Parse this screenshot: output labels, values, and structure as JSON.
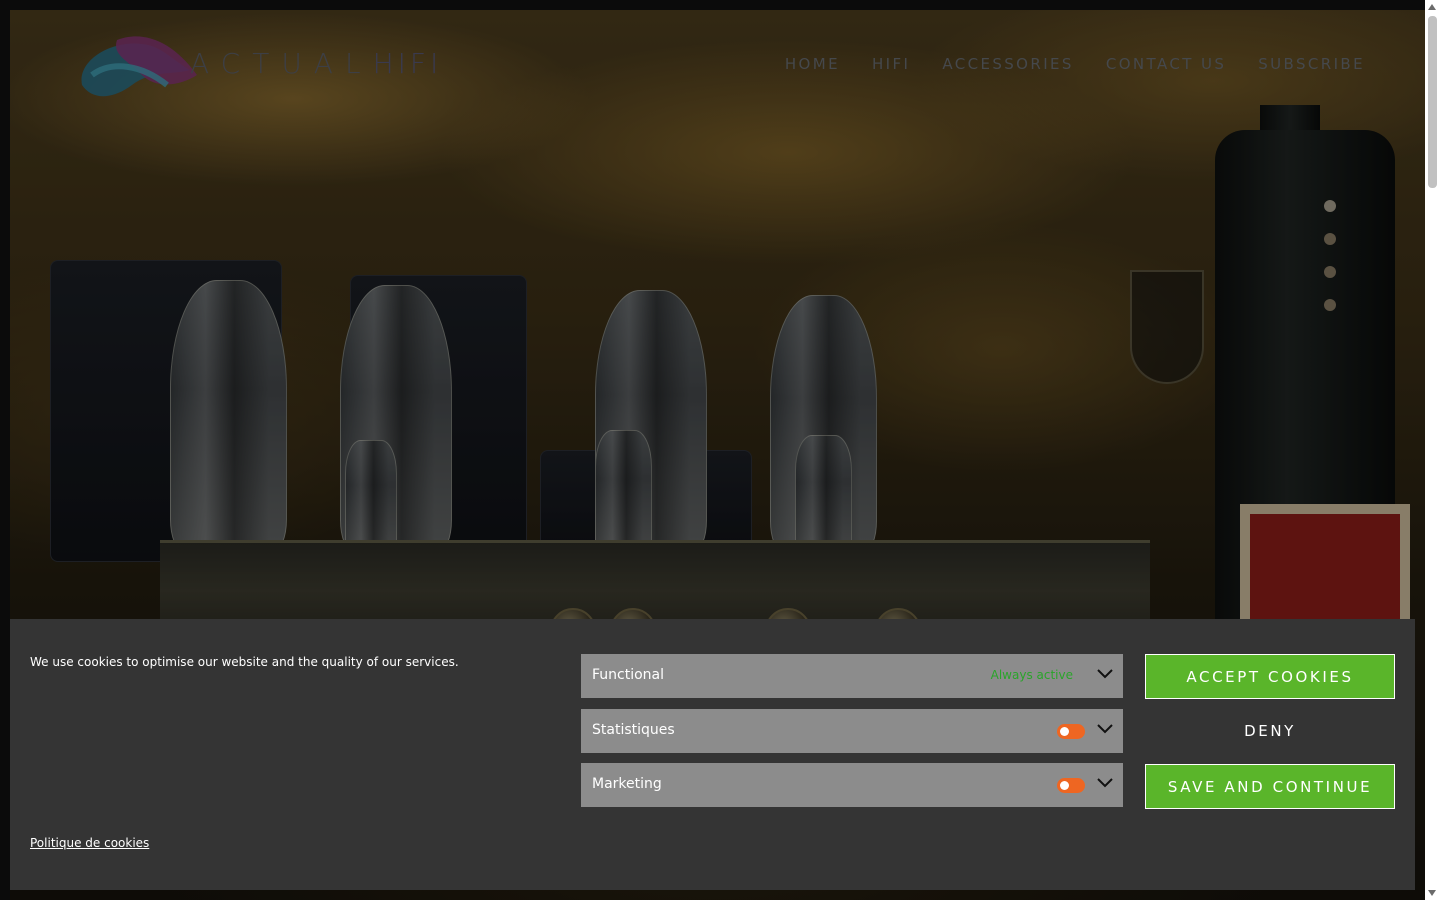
{
  "header": {
    "logo_text": "ACTUAL",
    "logo_suffix": "HIFI",
    "nav": [
      {
        "label": "HOME"
      },
      {
        "label": "HIFI"
      },
      {
        "label": "ACCESSORIES"
      },
      {
        "label": "CONTACT US"
      },
      {
        "label": "SUBSCRIBE"
      }
    ]
  },
  "carousel": {
    "slide_count": 4,
    "active_index": 0
  },
  "cookie_banner": {
    "message": "We use cookies to optimise our website and the quality of our services.",
    "policy_link": "Politique de cookies",
    "categories": [
      {
        "name": "Functional",
        "status": "Always active"
      },
      {
        "name": "Statistiques",
        "toggle_on": false
      },
      {
        "name": "Marketing",
        "toggle_on": false
      }
    ],
    "buttons": {
      "accept": "ACCEPT COOKIES",
      "deny": "DENY",
      "save": "SAVE AND CONTINUE"
    }
  },
  "colors": {
    "banner_bg": "#343434",
    "accent_green": "#5ab52a",
    "always_active_green": "#2aa52a",
    "toggle_orange": "#ee6622",
    "category_bg": "#8c8c8c"
  }
}
